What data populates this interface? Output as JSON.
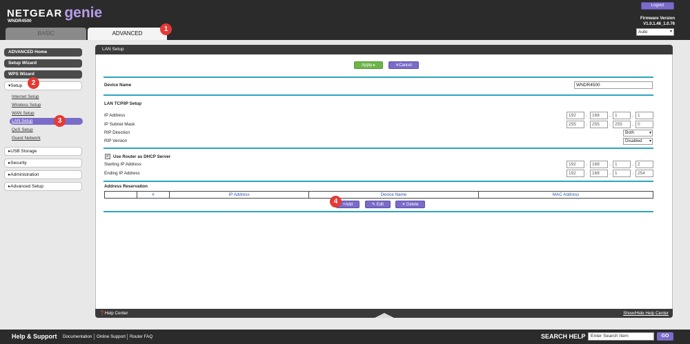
{
  "header": {
    "brand": "NETGEAR",
    "genie": "genie",
    "model": "WNDR4500",
    "logout": "Logout",
    "firmware_label": "Firmware Version",
    "firmware_value": "V1.0.1.46_1.0.76",
    "language": "Auto",
    "tabs": {
      "basic": "BASIC",
      "advanced": "ADVANCED"
    }
  },
  "callouts": [
    "1",
    "2",
    "3",
    "4"
  ],
  "sidebar": {
    "advanced_home": "ADVANCED Home",
    "setup_wizard": "Setup Wizard",
    "wps_wizard": "WPS Wizard",
    "setup": "▾Setup",
    "setup_items": [
      "Internet Setup",
      "Wireless Setup",
      "WAN Setup",
      "LAN Setup",
      "QoS Setup",
      "Guest Network"
    ],
    "usb_storage": "▸USB Storage",
    "security": "▸Security",
    "administration": "▸Administration",
    "advanced_setup": "▸Advanced Setup"
  },
  "panel": {
    "title": "LAN Setup",
    "apply": "Apply ▸",
    "cancel": "✕Cancel",
    "device_name_label": "Device Name",
    "device_name_value": "WNDR4500",
    "lan_tcpip_title": "LAN TCP/IP Setup",
    "ip_address_label": "IP Address",
    "ip_address": [
      "192",
      "168",
      "1",
      "1"
    ],
    "subnet_label": "IP Subnet Mask",
    "subnet": [
      "255",
      "255",
      "255",
      "0"
    ],
    "rip_direction_label": "RIP Direction",
    "rip_direction_value": "Both",
    "rip_version_label": "RIP Version",
    "rip_version_value": "Disabled",
    "dhcp_label": "Use Router as DHCP Server",
    "start_ip_label": "Starting IP Address",
    "start_ip": [
      "192",
      "168",
      "1",
      "2"
    ],
    "end_ip_label": "Ending IP Address",
    "end_ip": [
      "192",
      "168",
      "1",
      "254"
    ],
    "reservation_title": "Address Reservation",
    "columns": [
      "#",
      "IP Address",
      "Device Name",
      "MAC Address"
    ],
    "add": "+Add",
    "edit": "✎ Edit",
    "delete": "✕ Delete",
    "help_center": "❓Help Center",
    "show_hide_help": "Show/Hide Help Center"
  },
  "footer": {
    "help_support": "Help & Support",
    "links": [
      "Documentation",
      "Online Support",
      "Router FAQ"
    ],
    "search_help": "SEARCH HELP",
    "search_placeholder": "Enter Search Item",
    "go": "GO"
  },
  "colors": {
    "accent": "#7a6cc8",
    "apply": "#6bb54a",
    "rule": "#2aa5c0",
    "callout": "#e53935"
  }
}
